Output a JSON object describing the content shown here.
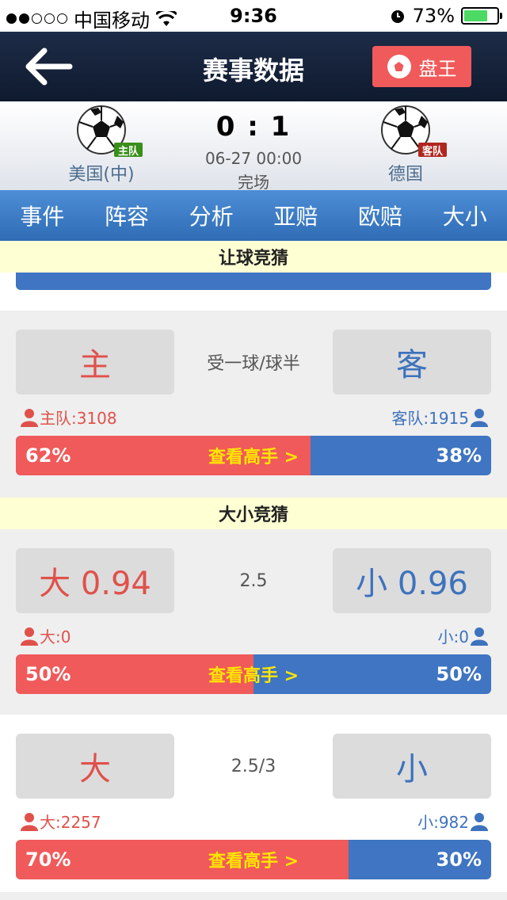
{
  "status_bar": {
    "carrier": "中国移动",
    "time": "9:36",
    "battery_pct": "73%",
    "battery_level": 0.73
  },
  "nav": {
    "title": "赛事数据",
    "panwang_label": "盘王",
    "back_icon": "back-arrow-icon"
  },
  "match": {
    "home": {
      "tag": "主队",
      "name": "美国(中)"
    },
    "away": {
      "tag": "客队",
      "name": "德国"
    },
    "score": "0 : 1",
    "datetime": "06-27 00:00",
    "status": "完场"
  },
  "tabs": [
    "事件",
    "阵容",
    "分析",
    "亚赔",
    "欧赔",
    "大小"
  ],
  "sections": {
    "handicap_header": "让球竞猜",
    "overunder_header": "大小竞猜"
  },
  "handicap": {
    "left_btn": "主",
    "line": "受一球/球半",
    "right_btn": "客",
    "left_count": "主队:3108",
    "right_count": "客队:1915",
    "left_pct": "62%",
    "right_pct": "38%",
    "left_ratio": 0.62,
    "center_label": "查看高手 >"
  },
  "overunder1": {
    "left_btn": "大 0.94",
    "line": "2.5",
    "right_btn": "小 0.96",
    "left_count": "大:0",
    "right_count": "小:0",
    "left_pct": "50%",
    "right_pct": "50%",
    "left_ratio": 0.5,
    "center_label": "查看高手 >"
  },
  "overunder2": {
    "left_btn": "大",
    "line": "2.5/3",
    "right_btn": "小",
    "left_count": "大:2257",
    "right_count": "小:982",
    "left_pct": "70%",
    "right_pct": "30%",
    "left_ratio": 0.7,
    "center_label": "查看高手 >"
  },
  "colors": {
    "home_red": "#f05a5a",
    "away_blue": "#3f75c2",
    "highlight_yellow": "#ffe600",
    "header_bg": "#ffffd4"
  }
}
